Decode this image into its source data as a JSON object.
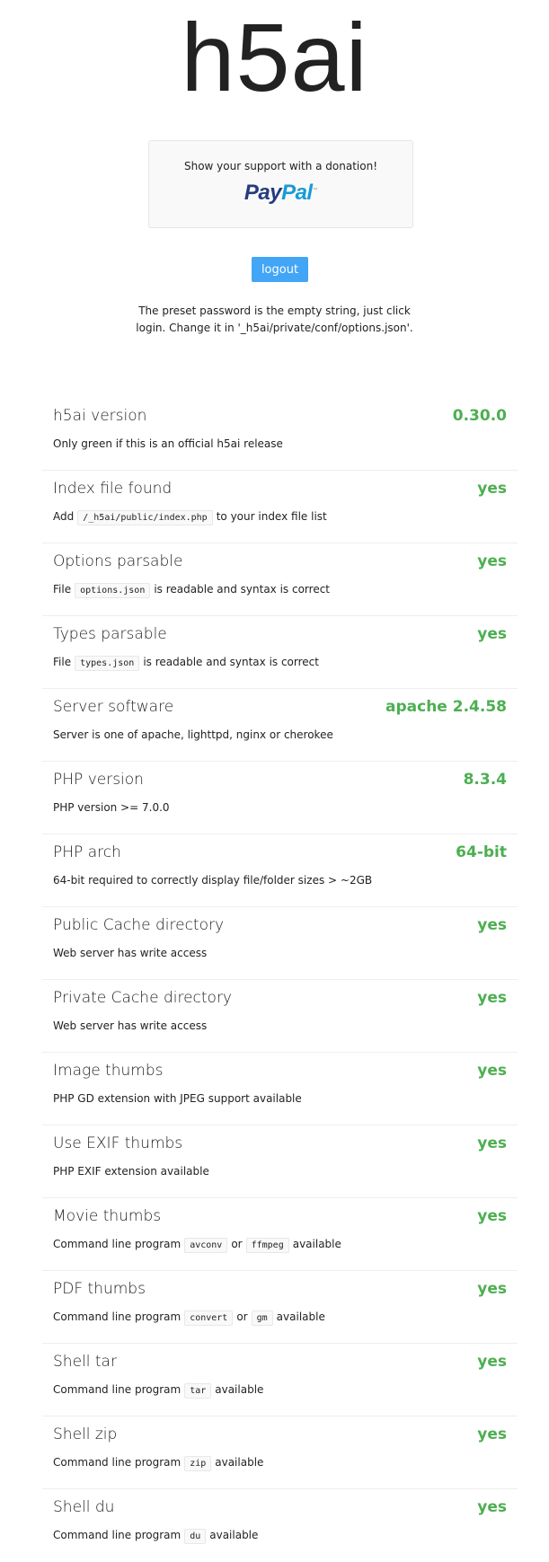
{
  "title": "h5ai",
  "donation": {
    "message": "Show your support with a donation!",
    "logo_pay": "Pay",
    "logo_pal": "Pal",
    "logo_tm": "™"
  },
  "logout_label": "logout",
  "note": "The preset password is the empty string, just click login. Change it in '_h5ai/private/conf/options.json'.",
  "status_color": "#4caf50",
  "rows": [
    {
      "title": "h5ai version",
      "value": "0.30.0",
      "desc": [
        {
          "text": "Only green if this is an official h5ai release"
        }
      ]
    },
    {
      "title": "Index file found",
      "value": "yes",
      "desc": [
        {
          "text": "Add"
        },
        {
          "code": "/_h5ai/public/index.php"
        },
        {
          "text": "to your index file list"
        }
      ]
    },
    {
      "title": "Options parsable",
      "value": "yes",
      "desc": [
        {
          "text": "File"
        },
        {
          "code": "options.json"
        },
        {
          "text": "is readable and syntax is correct"
        }
      ]
    },
    {
      "title": "Types parsable",
      "value": "yes",
      "desc": [
        {
          "text": "File"
        },
        {
          "code": "types.json"
        },
        {
          "text": "is readable and syntax is correct"
        }
      ]
    },
    {
      "title": "Server software",
      "value": "apache 2.4.58",
      "desc": [
        {
          "text": "Server is one of apache, lighttpd, nginx or cherokee"
        }
      ]
    },
    {
      "title": "PHP version",
      "value": "8.3.4",
      "desc": [
        {
          "text": "PHP version >= 7.0.0"
        }
      ]
    },
    {
      "title": "PHP arch",
      "value": "64-bit",
      "desc": [
        {
          "text": "64-bit required to correctly display file/folder sizes > ~2GB"
        }
      ]
    },
    {
      "title": "Public Cache directory",
      "value": "yes",
      "desc": [
        {
          "text": "Web server has write access"
        }
      ]
    },
    {
      "title": "Private Cache directory",
      "value": "yes",
      "desc": [
        {
          "text": "Web server has write access"
        }
      ]
    },
    {
      "title": "Image thumbs",
      "value": "yes",
      "desc": [
        {
          "text": "PHP GD extension with JPEG support available"
        }
      ]
    },
    {
      "title": "Use EXIF thumbs",
      "value": "yes",
      "desc": [
        {
          "text": "PHP EXIF extension available"
        }
      ]
    },
    {
      "title": "Movie thumbs",
      "value": "yes",
      "desc": [
        {
          "text": "Command line program"
        },
        {
          "code": "avconv"
        },
        {
          "text": "or"
        },
        {
          "code": "ffmpeg"
        },
        {
          "text": "available"
        }
      ]
    },
    {
      "title": "PDF thumbs",
      "value": "yes",
      "desc": [
        {
          "text": "Command line program"
        },
        {
          "code": "convert"
        },
        {
          "text": "or"
        },
        {
          "code": "gm"
        },
        {
          "text": "available"
        }
      ]
    },
    {
      "title": "Shell tar",
      "value": "yes",
      "desc": [
        {
          "text": "Command line program"
        },
        {
          "code": "tar"
        },
        {
          "text": "available"
        }
      ]
    },
    {
      "title": "Shell zip",
      "value": "yes",
      "desc": [
        {
          "text": "Command line program"
        },
        {
          "code": "zip"
        },
        {
          "text": "available"
        }
      ]
    },
    {
      "title": "Shell du",
      "value": "yes",
      "desc": [
        {
          "text": "Command line program"
        },
        {
          "code": "du"
        },
        {
          "text": "available"
        }
      ]
    }
  ]
}
